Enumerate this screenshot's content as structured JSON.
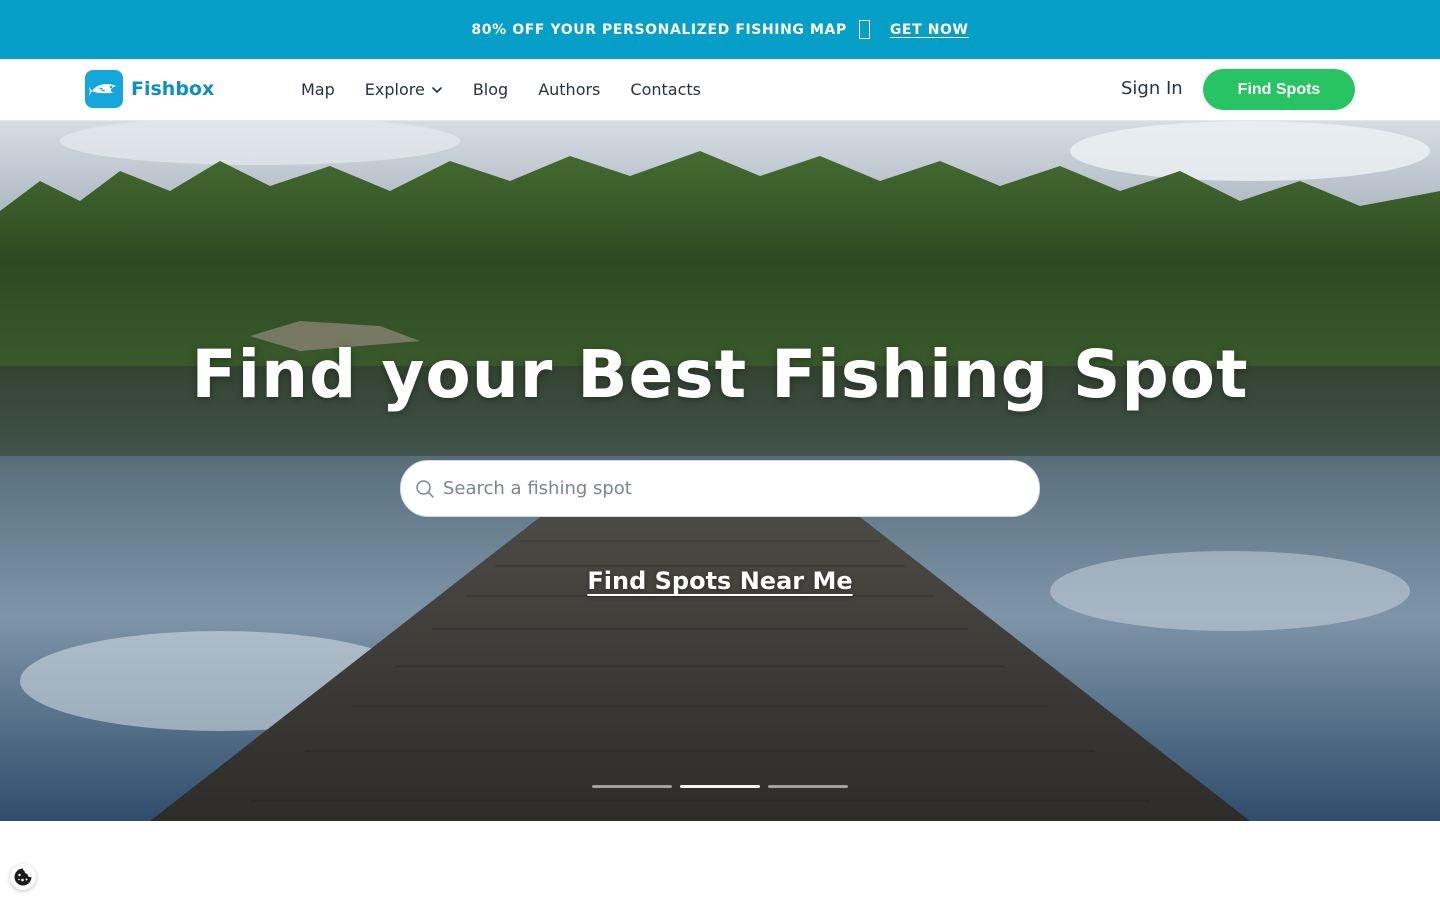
{
  "promo": {
    "text": "80% OFF YOUR PERSONALIZED FISHING MAP",
    "link": "GET NOW"
  },
  "header": {
    "logo_text": "Fishbox",
    "nav": [
      {
        "label": "Map"
      },
      {
        "label": "Explore"
      },
      {
        "label": "Blog"
      },
      {
        "label": "Authors"
      },
      {
        "label": "Contacts"
      }
    ],
    "sign_in": "Sign In",
    "cta": "Find Spots"
  },
  "hero": {
    "title": "Find your Best Fishing Spot",
    "search_placeholder": "Search a fishing spot",
    "near_me": "Find Spots Near Me",
    "slides_total": 3,
    "slide_active": 2
  },
  "colors": {
    "promo_bg": "#059fc8",
    "brand": "#14a7dc",
    "cta": "#28c463"
  },
  "icons": [
    "fish-logo-icon",
    "chevron-down-icon",
    "search-icon",
    "cookie-icon"
  ]
}
